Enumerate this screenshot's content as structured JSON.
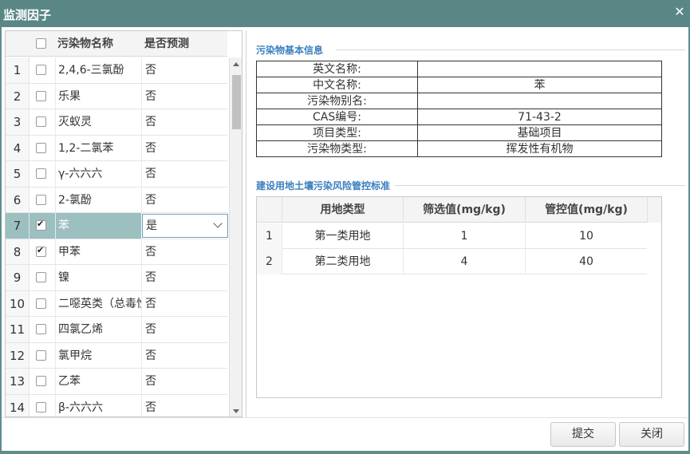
{
  "dialog": {
    "title": "监测因子"
  },
  "grid": {
    "columns": {
      "name": "污染物名称",
      "predict": "是否预测"
    },
    "rows": [
      {
        "num": "1",
        "name": "2,4,6-三氯酚",
        "predict": "否",
        "checked": false
      },
      {
        "num": "2",
        "name": "乐果",
        "predict": "否",
        "checked": false
      },
      {
        "num": "3",
        "name": "灭蚁灵",
        "predict": "否",
        "checked": false
      },
      {
        "num": "4",
        "name": "1,2-二氯苯",
        "predict": "否",
        "checked": false
      },
      {
        "num": "5",
        "name": "γ-六六六",
        "predict": "否",
        "checked": false
      },
      {
        "num": "6",
        "name": "2-氯酚",
        "predict": "否",
        "checked": false
      },
      {
        "num": "7",
        "name": "苯",
        "predict": "是",
        "checked": true,
        "selected": true
      },
      {
        "num": "8",
        "name": "甲苯",
        "predict": "否",
        "checked": true
      },
      {
        "num": "9",
        "name": "镍",
        "predict": "否",
        "checked": false
      },
      {
        "num": "10",
        "name": "二噁英类（总毒性当量）",
        "predict": "否",
        "checked": false
      },
      {
        "num": "11",
        "name": "四氯乙烯",
        "predict": "否",
        "checked": false
      },
      {
        "num": "12",
        "name": "氯甲烷",
        "predict": "否",
        "checked": false
      },
      {
        "num": "13",
        "name": "乙苯",
        "predict": "否",
        "checked": false
      },
      {
        "num": "14",
        "name": "β-六六六",
        "predict": "否",
        "checked": false
      }
    ]
  },
  "info": {
    "section_title": "污染物基本信息",
    "rows": [
      {
        "label": "英文名称:",
        "value": ""
      },
      {
        "label": "中文名称:",
        "value": "苯"
      },
      {
        "label": "污染物别名:",
        "value": ""
      },
      {
        "label": "CAS编号:",
        "value": "71-43-2"
      },
      {
        "label": "项目类型:",
        "value": "基础项目"
      },
      {
        "label": "污染物类型:",
        "value": "挥发性有机物"
      }
    ]
  },
  "standard": {
    "section_title": "建设用地土壤污染风险管控标准",
    "columns": {
      "land": "用地类型",
      "screen": "筛选值(mg/kg)",
      "control": "管控值(mg/kg)"
    },
    "rows": [
      {
        "num": "1",
        "land": "第一类用地",
        "screen": "1",
        "control": "10"
      },
      {
        "num": "2",
        "land": "第二类用地",
        "screen": "4",
        "control": "40"
      }
    ]
  },
  "footer": {
    "submit": "提交",
    "close": "关闭"
  },
  "colors": {
    "title_bar": "#5a8686",
    "selected_row": "#9cbfbf",
    "section_title": "#3a7fbf"
  }
}
